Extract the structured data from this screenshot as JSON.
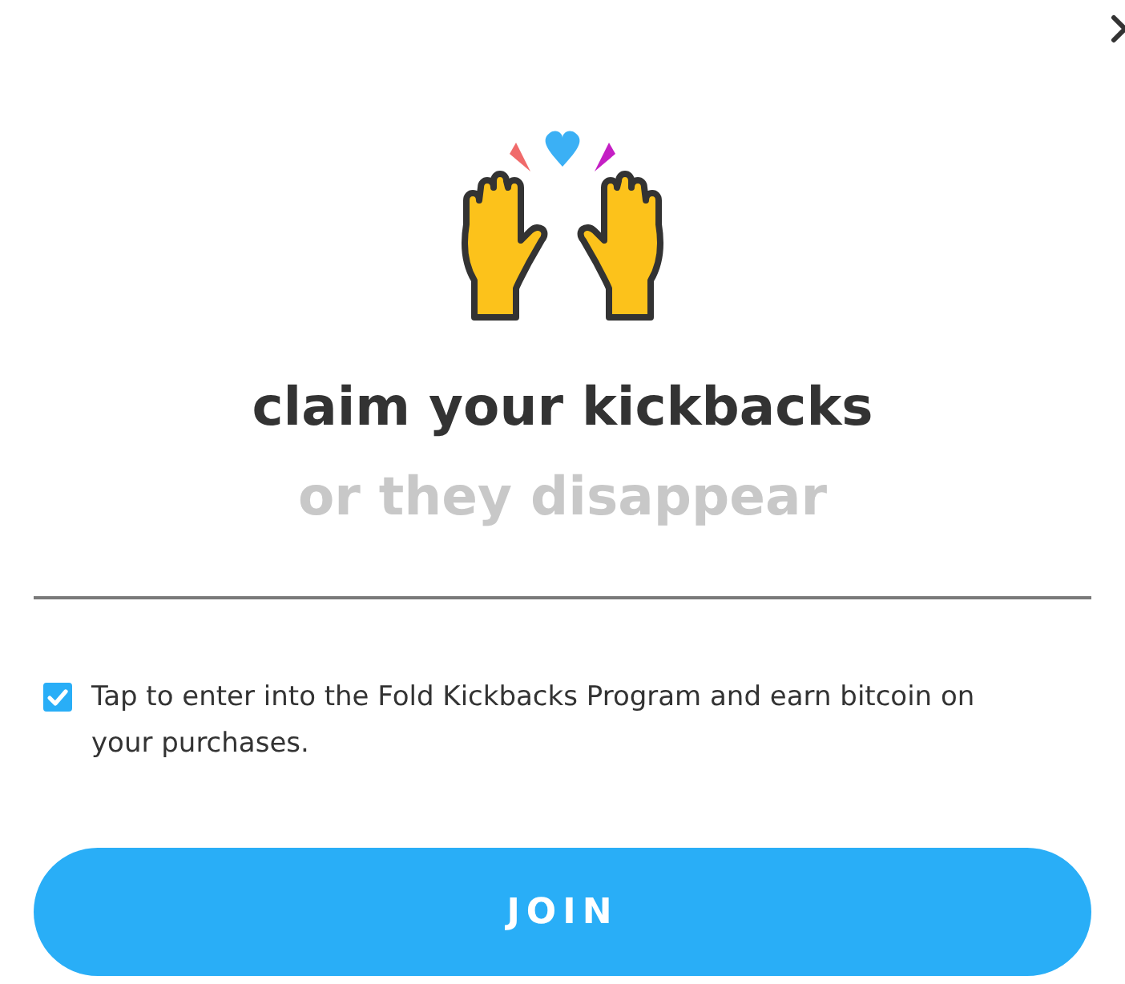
{
  "title": "claim your kickbacks",
  "subtitle": "or they disappear",
  "consent": {
    "label": "Tap to enter into the Fold Kickbacks Program and earn bitcoin on your purchases.",
    "checked": true
  },
  "button": "JOIN"
}
